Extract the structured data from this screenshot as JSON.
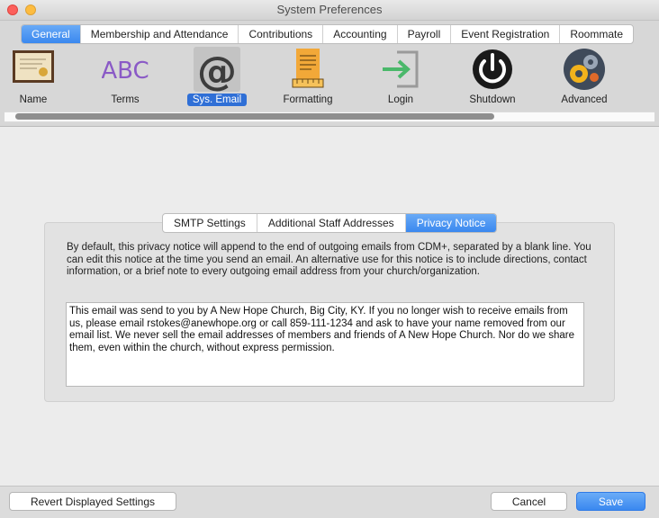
{
  "window": {
    "title": "System Preferences"
  },
  "top_tabs": [
    {
      "label": "General",
      "active": true
    },
    {
      "label": "Membership and Attendance",
      "active": false
    },
    {
      "label": "Contributions",
      "active": false
    },
    {
      "label": "Accounting",
      "active": false
    },
    {
      "label": "Payroll",
      "active": false
    },
    {
      "label": "Event Registration",
      "active": false
    },
    {
      "label": "Roommate",
      "active": false
    }
  ],
  "toolbar": {
    "items": [
      {
        "label": "Name",
        "icon": "certificate-icon",
        "selected": false
      },
      {
        "label": "Terms",
        "icon": "abc-text-icon",
        "selected": false
      },
      {
        "label": "Sys. Email",
        "icon": "at-sign-icon",
        "selected": true
      },
      {
        "label": "Formatting",
        "icon": "notepad-ruler-icon",
        "selected": false
      },
      {
        "label": "Login",
        "icon": "login-arrow-icon",
        "selected": false
      },
      {
        "label": "Shutdown",
        "icon": "power-icon",
        "selected": false
      },
      {
        "label": "Advanced",
        "icon": "gears-icon",
        "selected": false
      }
    ]
  },
  "email_tabs": [
    {
      "label": "SMTP Settings",
      "active": false
    },
    {
      "label": "Additional Staff Addresses",
      "active": false
    },
    {
      "label": "Privacy Notice",
      "active": true
    }
  ],
  "privacy": {
    "description": "By default, this privacy notice will append to the end of outgoing emails from CDM+, separated by a blank line. You can edit this notice at the time you send an email. An alternative use for this notice is to include directions, contact information, or a brief note to every outgoing email address from your church/organization.",
    "notice_text": "This email was send to you by A New Hope Church, Big City, KY. If you no longer wish to receive emails from us, please email rstokes@anewhope.org or call 859-111-1234 and ask to have your name removed from our email list. We never sell the email addresses of members and friends of A New Hope Church. Nor do we share them, even within the church, without express permission."
  },
  "buttons": {
    "revert": "Revert Displayed Settings",
    "cancel": "Cancel",
    "save": "Save"
  },
  "colors": {
    "accent": "#3a88ef",
    "selection": "#2f6fd6",
    "window_bg": "#ececec"
  }
}
